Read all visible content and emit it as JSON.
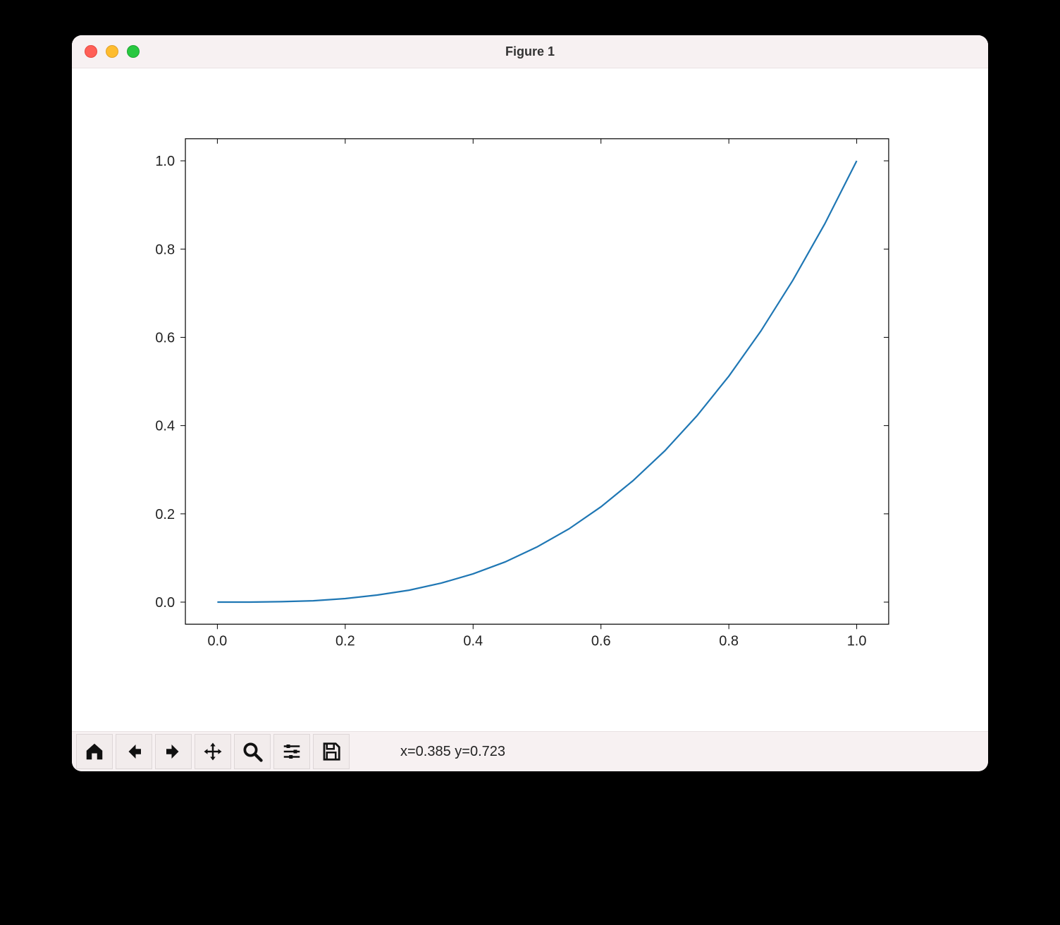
{
  "window": {
    "title": "Figure 1"
  },
  "status": {
    "coords": "x=0.385 y=0.723"
  },
  "chart_data": {
    "type": "line",
    "x": [
      0.0,
      0.05,
      0.1,
      0.15,
      0.2,
      0.25,
      0.3,
      0.35,
      0.4,
      0.45,
      0.5,
      0.55,
      0.6,
      0.65,
      0.7,
      0.75,
      0.8,
      0.85,
      0.9,
      0.95,
      1.0
    ],
    "y": [
      0.0,
      0.0,
      0.001,
      0.003,
      0.008,
      0.016,
      0.027,
      0.043,
      0.064,
      0.091,
      0.125,
      0.166,
      0.216,
      0.275,
      0.343,
      0.422,
      0.512,
      0.614,
      0.729,
      0.857,
      1.0
    ],
    "title": "",
    "xlabel": "",
    "ylabel": "",
    "xticks": [
      "0.0",
      "0.2",
      "0.4",
      "0.6",
      "0.8",
      "1.0"
    ],
    "yticks": [
      "0.0",
      "0.2",
      "0.4",
      "0.6",
      "0.8",
      "1.0"
    ],
    "xlim": [
      -0.05,
      1.05
    ],
    "ylim": [
      -0.05,
      1.05
    ],
    "line_color": "#1f77b4"
  },
  "toolbar": {
    "buttons": [
      "home",
      "back",
      "forward",
      "pan",
      "zoom",
      "configure",
      "save"
    ]
  }
}
